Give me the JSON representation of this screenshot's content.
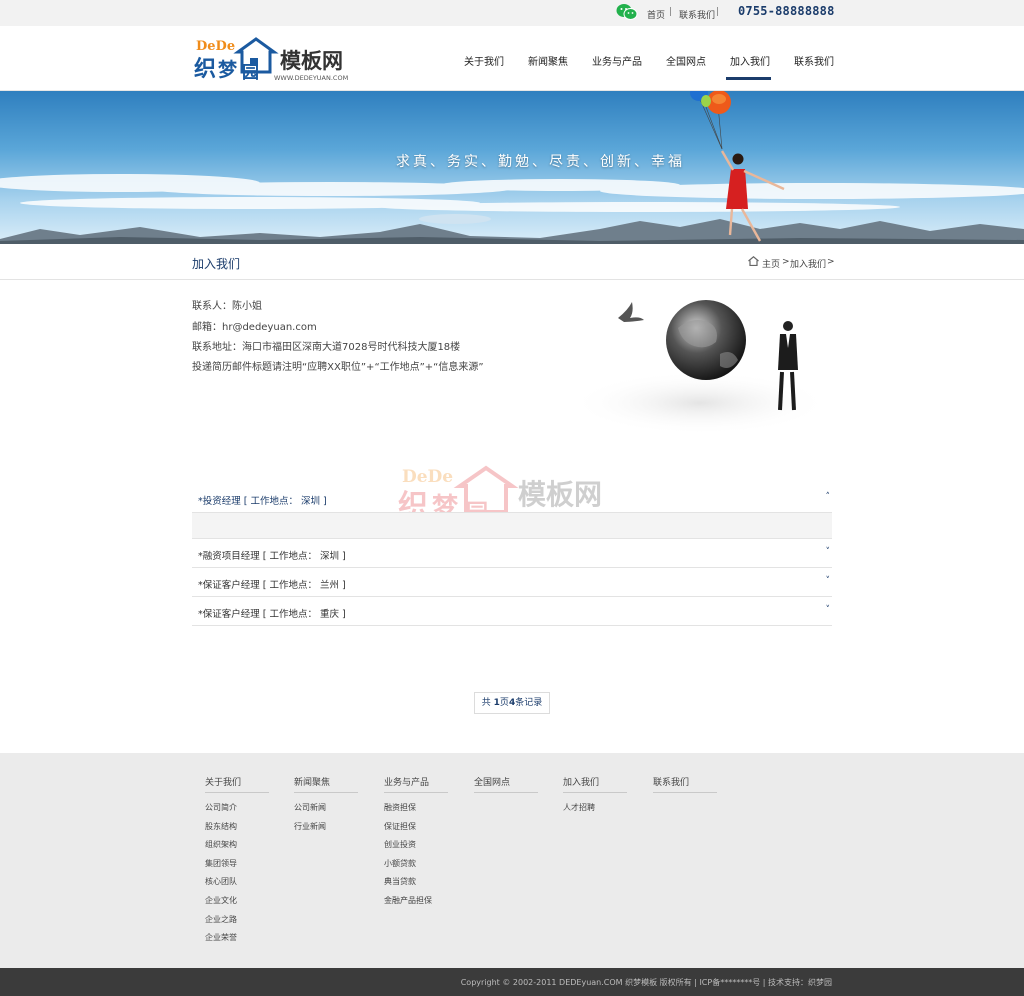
{
  "colors": {
    "brand": "#1b3c6b",
    "footer_bg": "#ebebeb",
    "copyright_bg": "#3b3b3b",
    "wechat": "#22b14c"
  },
  "topbar": {
    "home": "首页",
    "sep1": "|",
    "contact": "联系我们",
    "sep2": "|",
    "phone": "0755-88888888"
  },
  "logo": {
    "dede": "DeDe",
    "zhi": "织",
    "meng": "梦",
    "yuan": "园",
    "moban": "模板网",
    "site": "WWW.DEDEYUAN.COM"
  },
  "nav": [
    {
      "label": "关于我们"
    },
    {
      "label": "新闻聚焦"
    },
    {
      "label": "业务与产品"
    },
    {
      "label": "全国网点"
    },
    {
      "label": "加入我们",
      "active": true
    },
    {
      "label": "联系我们"
    }
  ],
  "banner": {
    "slogan": "求真、务实、勤勉、尽责、创新、幸福"
  },
  "titlebar": {
    "title": "加入我们",
    "home": "主页",
    "sep": ">",
    "current": "加入我们",
    "end": ">"
  },
  "contact": {
    "person": "联系人：陈小姐",
    "email": "邮箱：hr@dedeyuan.com",
    "address": "联系地址：海口市福田区深南大道7028号时代科技大厦18楼",
    "note": "投递简历邮件标题请注明“应聘XX职位”+“工作地点”+“信息来源”"
  },
  "jobs": [
    {
      "label": "*投资经理 [ 工作地点： 深圳 ]",
      "open": true,
      "chev": "˄"
    },
    {
      "label": "*融资项目经理 [ 工作地点： 深圳 ]",
      "open": false,
      "chev": "˅"
    },
    {
      "label": "*保证客户经理 [ 工作地点： 兰州 ]",
      "open": false,
      "chev": "˅"
    },
    {
      "label": "*保证客户经理 [ 工作地点： 重庆 ]",
      "open": false,
      "chev": "˅"
    }
  ],
  "pager": {
    "pre": "共 ",
    "pages": "1",
    "mid": "页",
    "count": "4",
    "post": "条记录"
  },
  "footer": {
    "cols": [
      {
        "head": "关于我们",
        "items": [
          "公司简介",
          "股东结构",
          "组织架构",
          "集团领导",
          "核心团队",
          "企业文化",
          "企业之路",
          "企业荣誉"
        ]
      },
      {
        "head": "新闻聚焦",
        "items": [
          "公司新闻",
          "行业新闻"
        ]
      },
      {
        "head": "业务与产品",
        "items": [
          "融资担保",
          "保证担保",
          "创业投资",
          "小额贷款",
          "典当贷款",
          "金融产品担保"
        ]
      },
      {
        "head": "全国网点",
        "items": []
      },
      {
        "head": "加入我们",
        "items": [
          "人才招聘"
        ]
      },
      {
        "head": "联系我们",
        "items": []
      }
    ],
    "copyright": "Copyright © 2002-2011 DEDEyuan.COM 织梦模板 版权所有 | ICP备********号 | 技术支持：织梦园"
  }
}
